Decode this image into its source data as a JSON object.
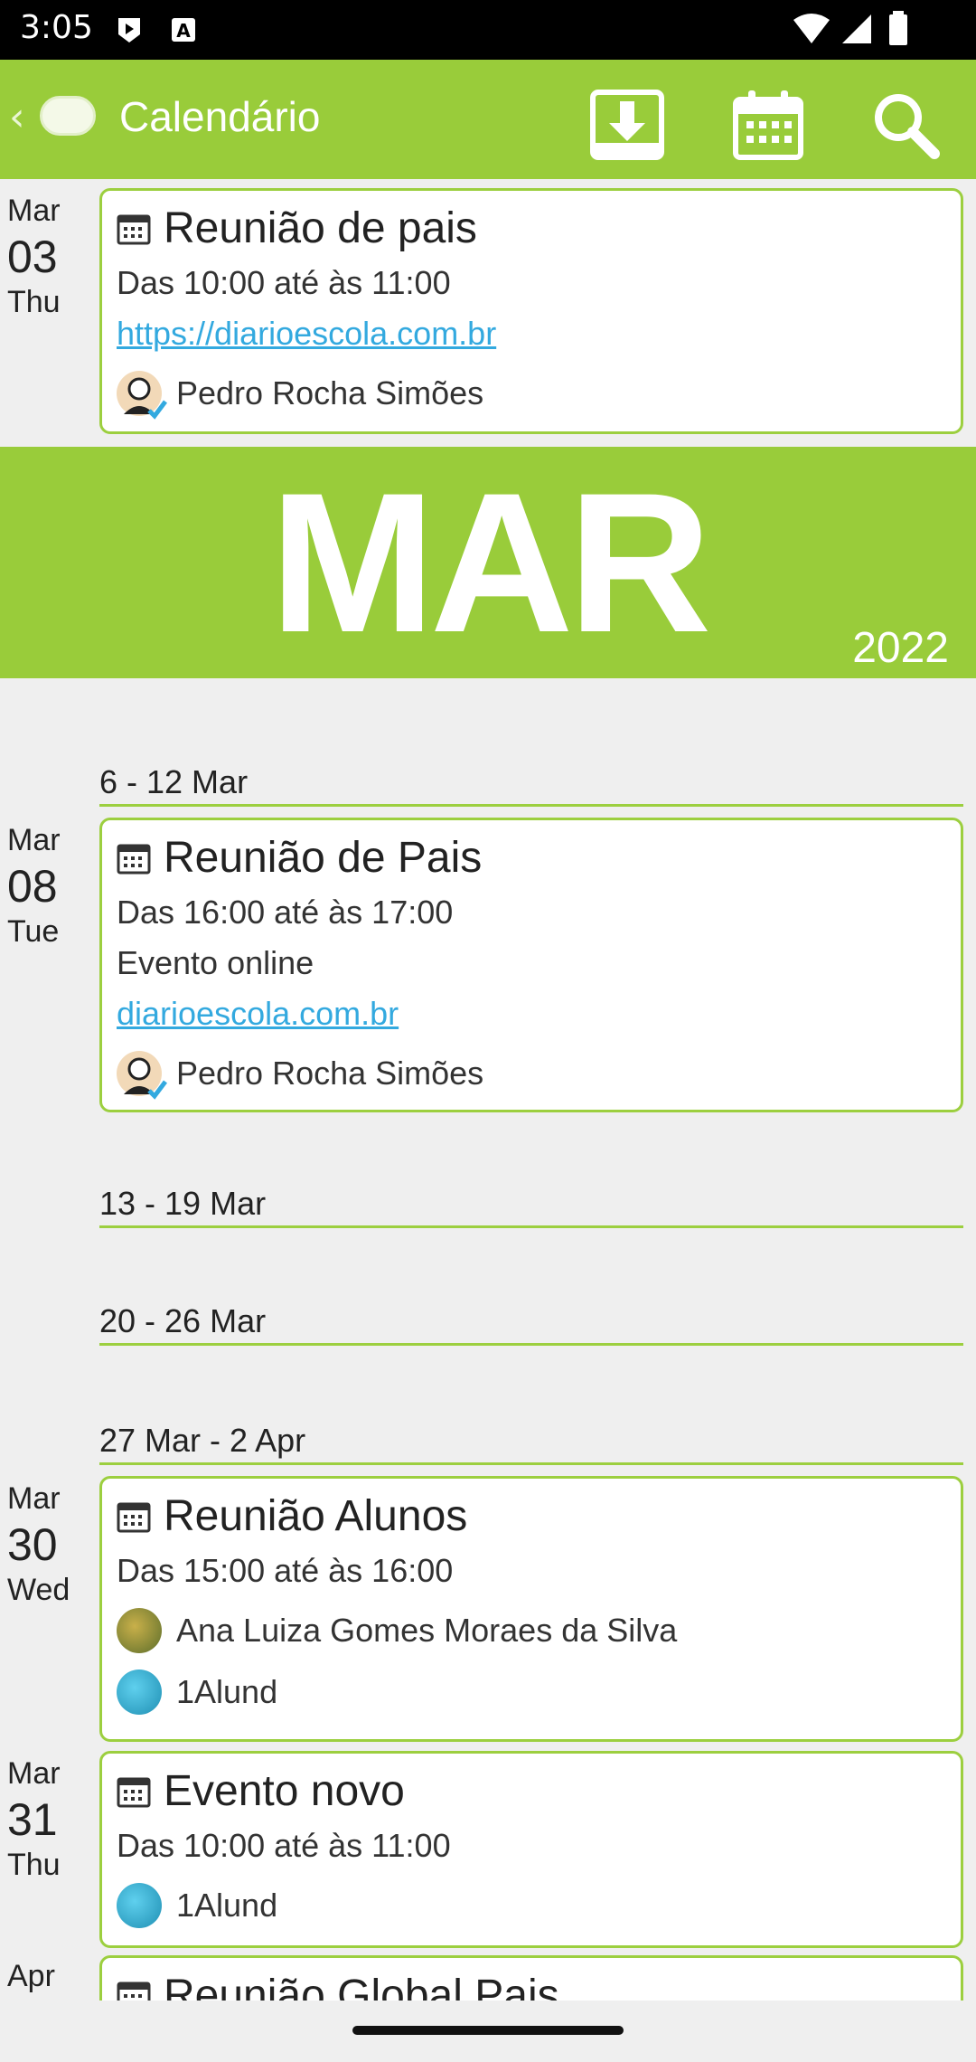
{
  "status": {
    "time": "3:05"
  },
  "appbar": {
    "back_icon": "chevron-left-icon",
    "title": "Calendário",
    "actions": [
      "download-icon",
      "calendar-icon",
      "search-icon"
    ]
  },
  "events": [
    {
      "month": "Mar",
      "day": "03",
      "weekday": "Thu",
      "title": "Reunião de pais",
      "time": "Das 10:00 até às 11:00",
      "extra": "",
      "link": "https://diarioescola.com.br",
      "people": [
        "Pedro Rocha Simões"
      ]
    },
    {
      "month": "Mar",
      "day": "08",
      "weekday": "Tue",
      "title": "Reunião de Pais",
      "time": "Das 16:00 até às 17:00",
      "extra": "Evento online",
      "link": "diarioescola.com.br",
      "people": [
        "Pedro Rocha Simões"
      ]
    },
    {
      "month": "Mar",
      "day": "30",
      "weekday": "Wed",
      "title": "Reunião Alunos",
      "time": "Das 15:00 até às 16:00",
      "extra": "",
      "link": "",
      "people": [
        "Ana Luiza Gomes Moraes da Silva",
        "1Alund"
      ]
    },
    {
      "month": "Mar",
      "day": "31",
      "weekday": "Thu",
      "title": "Evento novo",
      "time": "Das 10:00 até às 11:00",
      "extra": "",
      "link": "",
      "people": [
        "1Alund"
      ]
    },
    {
      "month": "Apr",
      "day": "",
      "weekday": "",
      "title": "Reunião Global Pais",
      "time": "",
      "extra": "",
      "link": "",
      "people": []
    }
  ],
  "banner": {
    "month": "MAR",
    "year": "2022"
  },
  "weeks": [
    "6 - 12 Mar",
    "13 - 19 Mar",
    "20 - 26 Mar",
    "27 Mar - 2 Apr"
  ],
  "colors": {
    "accent": "#99cc3a",
    "link": "#33a9df",
    "background": "#efefef"
  }
}
